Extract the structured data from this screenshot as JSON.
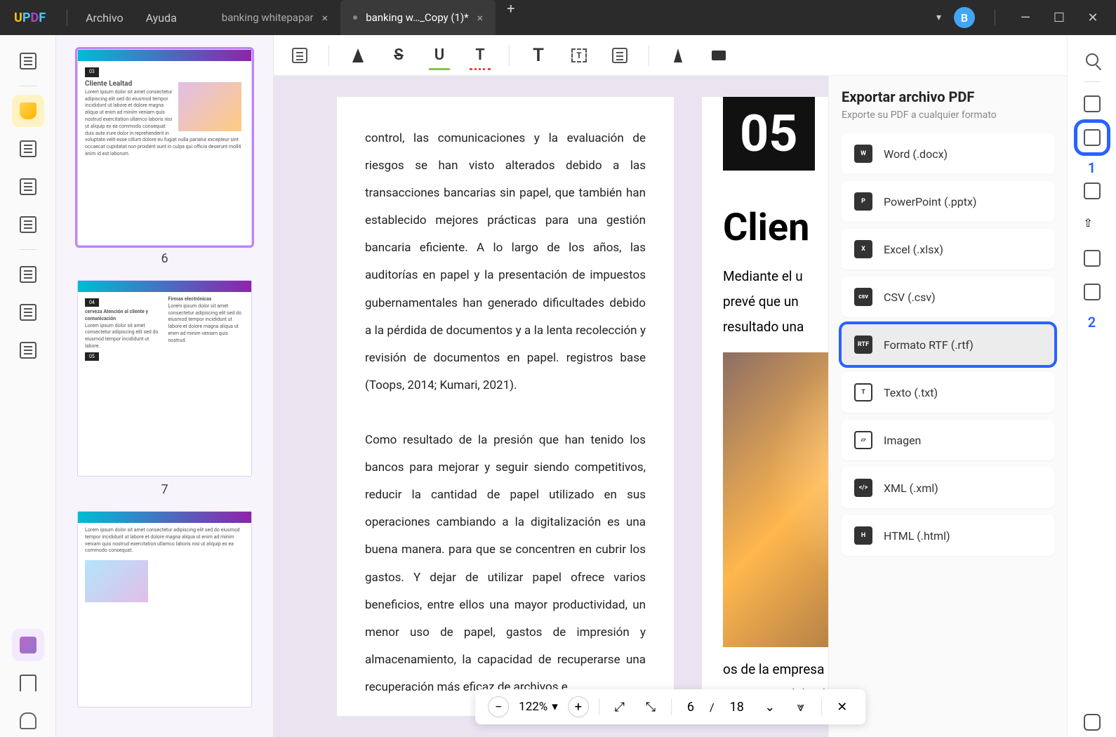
{
  "menus": {
    "file": "Archivo",
    "help": "Ayuda"
  },
  "tabs": {
    "inactive": "banking whitepapar",
    "active": "banking w…_Copy (1)*"
  },
  "avatar_letter": "B",
  "thumbnails": {
    "p6": "6",
    "p7": "7",
    "p6_title": "Cliente Lealtad",
    "p6_badge": "03",
    "p7_badge1": "04",
    "p7_badge2": "05",
    "p7_t1": "Firmas electrónicas",
    "p7_t2": "cerveza Atención al cliente y comunicación"
  },
  "tools": {
    "strike": "S",
    "under": "U",
    "curl": "T",
    "bigT": "T"
  },
  "doc": {
    "para1": "control, las comunicaciones y la evaluación de riesgos se han visto alterados debido a las transacciones bancarias sin papel, que también han establecido mejores prácticas para una gestión bancaria eficiente. A lo largo de los años, las auditorías en papel y la presentación de impuestos gubernamentales han generado dificultades debido a la pérdida de documentos y a la lenta recolección y revisión de documentos en papel. registros base (Toops, 2014; Kumari, 2021).",
    "para2": "Como resultado de la presión que han tenido los bancos para mejorar y seguir siendo competitivos, reducir la cantidad de papel utilizado en sus operaciones cambiando a la digitalización es una buena manera. para que se concentren en cubrir los gastos. Y dejar de utilizar papel ofrece varios beneficios, entre ellos una mayor productividad, un menor uso de papel, gastos de impresión y almacenamiento, la capacidad de recuperarse una recuperación más eficaz de archivos e",
    "badge": "05",
    "heading": "Clien",
    "p2a": "Mediante el u",
    "p2b": "prevé que un",
    "p2c": "resultado una",
    "p2d": "os de la empresa deberían bajar y sus ganancias deberían aumentar."
  },
  "zoom": {
    "value": "122%",
    "page": "6",
    "sep": "/",
    "total": "18"
  },
  "export": {
    "title": "Exportar archivo PDF",
    "subtitle": "Exporte su PDF a cualquier formato",
    "word": "Word (.docx)",
    "ppt": "PowerPoint (.pptx)",
    "excel": "Excel (.xlsx)",
    "csv": "CSV (.csv)",
    "rtf": "Formato RTF (.rtf)",
    "txt": "Texto (.txt)",
    "img": "Imagen",
    "xml": "XML (.xml)",
    "html": "HTML (.html)"
  },
  "annotations": {
    "one": "1",
    "two": "2"
  }
}
